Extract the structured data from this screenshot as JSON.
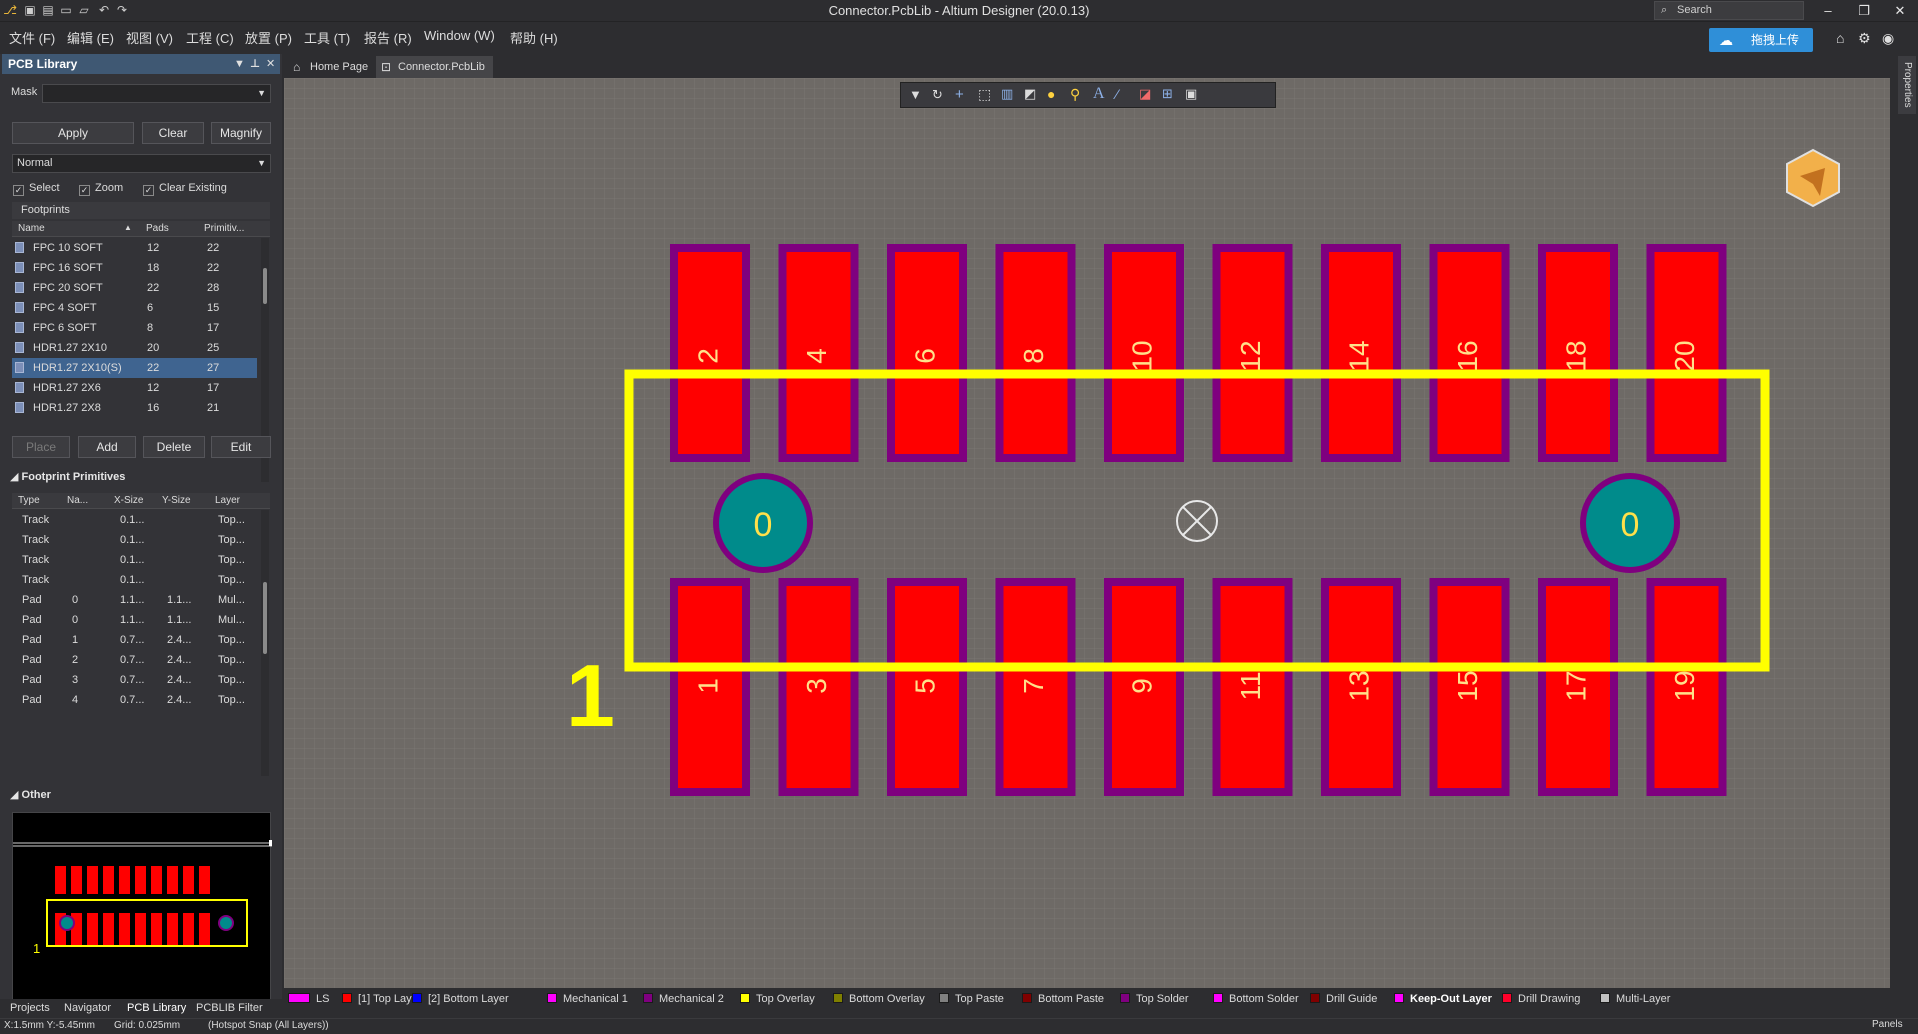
{
  "app": {
    "title": "Connector.PcbLib - Altium Designer (20.0.13)",
    "search_placeholder": "Search",
    "upload_label": "拖拽上传"
  },
  "menus": [
    "文件 (F)",
    "编辑 (E)",
    "视图 (V)",
    "工程 (C)",
    "放置 (P)",
    "工具 (T)",
    "报告 (R)",
    "Window (W)",
    "帮助 (H)"
  ],
  "panel": {
    "title": "PCB Library",
    "mask_label": "Mask",
    "mask_value": "",
    "buttons": {
      "apply": "Apply",
      "clear": "Clear",
      "magnify": "Magnify"
    },
    "mode": "Normal",
    "checks": {
      "select": "Select",
      "zoom": "Zoom",
      "clear_existing": "Clear Existing"
    },
    "footprints_group": "Footprints",
    "footprint_columns": [
      "Name",
      "Pads",
      "Primitiv..."
    ],
    "footprints": [
      {
        "name": "FPC 10 SOFT",
        "pads": "12",
        "prims": "22"
      },
      {
        "name": "FPC 16 SOFT",
        "pads": "18",
        "prims": "22"
      },
      {
        "name": "FPC 20 SOFT",
        "pads": "22",
        "prims": "28"
      },
      {
        "name": "FPC 4 SOFT",
        "pads": "6",
        "prims": "15"
      },
      {
        "name": "FPC 6 SOFT",
        "pads": "8",
        "prims": "17"
      },
      {
        "name": "HDR1.27 2X10",
        "pads": "20",
        "prims": "25"
      },
      {
        "name": "HDR1.27 2X10(S)",
        "pads": "22",
        "prims": "27"
      },
      {
        "name": "HDR1.27 2X6",
        "pads": "12",
        "prims": "17"
      },
      {
        "name": "HDR1.27 2X8",
        "pads": "16",
        "prims": "21"
      }
    ],
    "selected_footprint": 6,
    "action_buttons": {
      "place": "Place",
      "add": "Add",
      "delete": "Delete",
      "edit": "Edit"
    },
    "primitives_title": "Footprint Primitives",
    "primitive_columns": [
      "Type",
      "Na...",
      "X-Size",
      "Y-Size",
      "Layer"
    ],
    "primitives": [
      {
        "type": "Track",
        "name": "",
        "x": "0.1...",
        "y": "",
        "layer": "Top..."
      },
      {
        "type": "Track",
        "name": "",
        "x": "0.1...",
        "y": "",
        "layer": "Top..."
      },
      {
        "type": "Track",
        "name": "",
        "x": "0.1...",
        "y": "",
        "layer": "Top..."
      },
      {
        "type": "Track",
        "name": "",
        "x": "0.1...",
        "y": "",
        "layer": "Top..."
      },
      {
        "type": "Pad",
        "name": "0",
        "x": "1.1...",
        "y": "1.1...",
        "layer": "Mul..."
      },
      {
        "type": "Pad",
        "name": "0",
        "x": "1.1...",
        "y": "1.1...",
        "layer": "Mul..."
      },
      {
        "type": "Pad",
        "name": "1",
        "x": "0.7...",
        "y": "2.4...",
        "layer": "Top..."
      },
      {
        "type": "Pad",
        "name": "2",
        "x": "0.7...",
        "y": "2.4...",
        "layer": "Top..."
      },
      {
        "type": "Pad",
        "name": "3",
        "x": "0.7...",
        "y": "2.4...",
        "layer": "Top..."
      },
      {
        "type": "Pad",
        "name": "4",
        "x": "0.7...",
        "y": "2.4...",
        "layer": "Top..."
      }
    ],
    "other_title": "Other",
    "preview_label": "1"
  },
  "panel_tabs": [
    "Projects",
    "Navigator",
    "PCB Library",
    "PCBLIB Filter"
  ],
  "doc_tabs": [
    "Home Page",
    "Connector.PcbLib"
  ],
  "props_tab": "Properties",
  "pcb": {
    "top_pads": [
      "2",
      "4",
      "6",
      "8",
      "10",
      "12",
      "14",
      "16",
      "18",
      "20"
    ],
    "bottom_pads": [
      "1",
      "3",
      "5",
      "7",
      "9",
      "11",
      "13",
      "15",
      "17",
      "19"
    ],
    "mount_label": "0",
    "pin1_label": "1",
    "colors": {
      "pad": "#ff0000",
      "mask": "#7f007f",
      "overlay": "#ffff00",
      "mount": "#008b8b",
      "canvas": "#6e6a66",
      "grid": "#7c7874"
    }
  },
  "layers": [
    {
      "name": "LS",
      "color": "#ff00ff"
    },
    {
      "name": "[1] Top Layer",
      "color": "#ff0000"
    },
    {
      "name": "[2] Bottom Layer",
      "color": "#0000ff"
    },
    {
      "name": "Mechanical 1",
      "color": "#ff00ff"
    },
    {
      "name": "Mechanical 2",
      "color": "#800080"
    },
    {
      "name": "Top Overlay",
      "color": "#ffff00"
    },
    {
      "name": "Bottom Overlay",
      "color": "#808000"
    },
    {
      "name": "Top Paste",
      "color": "#808080"
    },
    {
      "name": "Bottom Paste",
      "color": "#800000"
    },
    {
      "name": "Top Solder",
      "color": "#800080"
    },
    {
      "name": "Bottom Solder",
      "color": "#ff00ff"
    },
    {
      "name": "Drill Guide",
      "color": "#800000"
    },
    {
      "name": "Keep-Out Layer",
      "color": "#ff00ff"
    },
    {
      "name": "Drill Drawing",
      "color": "#ff002a"
    },
    {
      "name": "Multi-Layer",
      "color": "#c0c0c0"
    }
  ],
  "status": {
    "coords": "X:1.5mm Y:-5.45mm",
    "grid": "Grid: 0.025mm",
    "snap": "(Hotspot Snap (All Layers))",
    "panels": "Panels"
  }
}
